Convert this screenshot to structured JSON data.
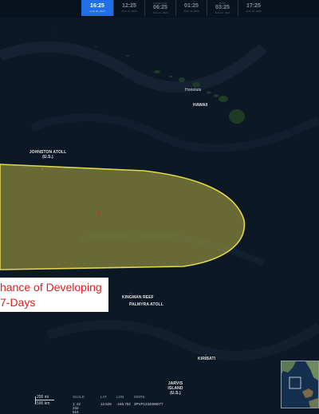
{
  "colors": {
    "ocean": "#0d1826",
    "land": "#1e3b26",
    "zone_fill": "#8a8a3c",
    "zone_stroke": "#e3d84a",
    "active_time": "#1f6fe8",
    "chance_text": "#e21e1e"
  },
  "timeline": [
    {
      "top": "",
      "time": "16:25",
      "date": "AUG 30, 2020",
      "active": true
    },
    {
      "top": "",
      "time": "12:25",
      "date": "AUG 31, 2020",
      "active": false
    },
    {
      "top": "FORECAST",
      "time": "06:25",
      "date": "AUG 31, 2020",
      "active": false
    },
    {
      "top": "",
      "time": "01:25",
      "date": "AUG 31, 2020",
      "active": false
    },
    {
      "top": "NOW",
      "time": "03:25",
      "date": "AUG 31, 2020",
      "active": false
    },
    {
      "top": "",
      "time": "17:25",
      "date": "AUG 31, 2020",
      "active": false
    }
  ],
  "labels": {
    "honolulu": "Honolulu",
    "hawaii": "HAWAII",
    "johnston_1": "JOHNSTON ATOLL",
    "johnston_2": "(U.S.)",
    "kingman": "KINGMAN REEF",
    "palmyra": "PALMYRA ATOLL",
    "kiribati": "KIRIBATI",
    "jarvis_1": "JARVIS",
    "jarvis_2": "ISLAND",
    "jarvis_3": "(U.S.)"
  },
  "chance_box": {
    "line1": "hance of Developing",
    "line2": "7-Days"
  },
  "footer": {
    "scale_mi": "200 mi",
    "scale_km": "500 km",
    "scale_head": "SCALE",
    "scale_val": "1: 22 232 515",
    "lat_head": "LAT",
    "lat_val": "12.628",
    "lon_head": "LON",
    "lon_val": "-165.752",
    "mgrs_head": "MGRS",
    "mgrs_val": "3PVP1234096077"
  }
}
